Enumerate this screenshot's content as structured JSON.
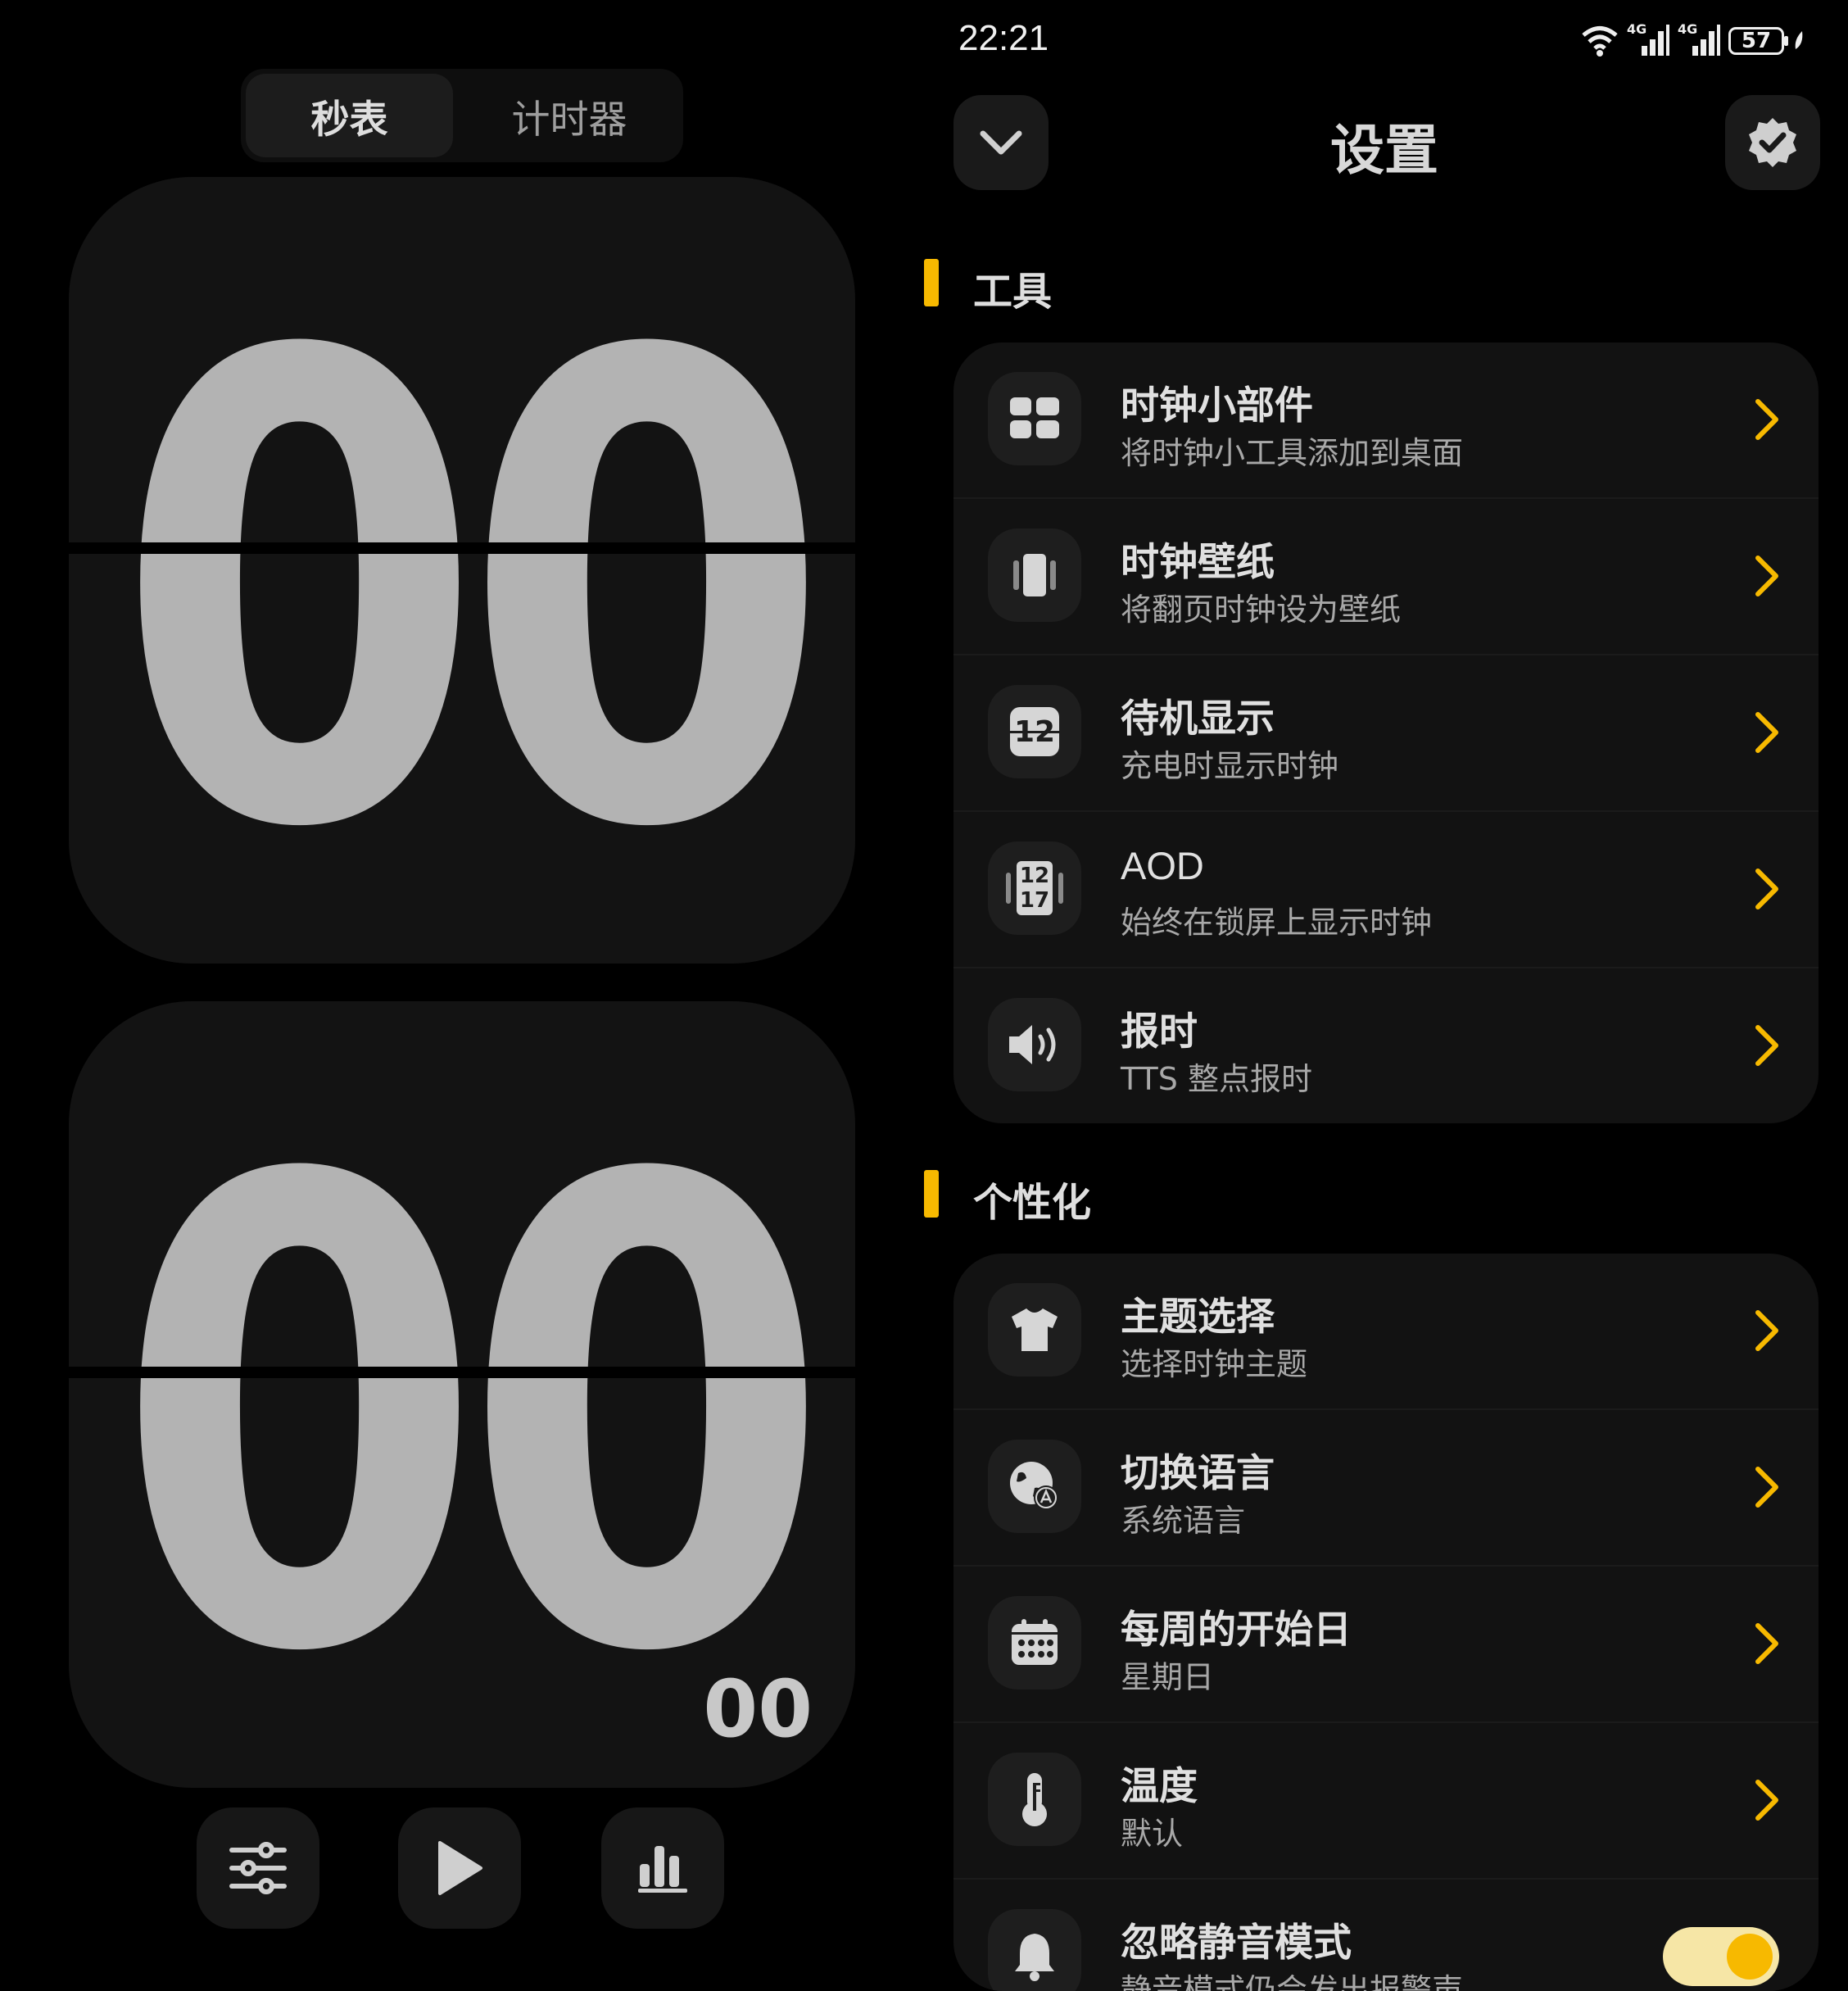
{
  "status_bar": {
    "time": "22:21",
    "network1": "4G",
    "network2": "4G",
    "battery": "57"
  },
  "stopwatch": {
    "tabs": [
      {
        "label": "秒表",
        "active": true
      },
      {
        "label": "计时器",
        "active": false
      }
    ],
    "minutes": "00",
    "seconds": "00",
    "milliseconds": "00",
    "controls": [
      "sliders-icon",
      "play-icon",
      "bar-chart-icon"
    ]
  },
  "settings": {
    "title": "设置",
    "back_icon": "chevron-down-icon",
    "badge_icon": "verified-badge-icon",
    "accent": "#f7b900",
    "sections": [
      {
        "label": "工具",
        "items": [
          {
            "title": "时钟小部件",
            "subtitle": "将时钟小工具添加到桌面",
            "icon": "widgets-icon"
          },
          {
            "title": "时钟壁纸",
            "subtitle": "将翻页时钟设为壁纸",
            "icon": "wallpaper-icon"
          },
          {
            "title": "待机显示",
            "subtitle": "充电时显示时钟",
            "icon": "standby-clock-icon",
            "icon_text": "12"
          },
          {
            "title": "AOD",
            "subtitle": "始终在锁屏上显示时钟",
            "icon": "aod-icon",
            "icon_text": [
              "12",
              "17"
            ]
          },
          {
            "title": "报时",
            "subtitle": "TTS 整点报时",
            "icon": "speaker-icon"
          }
        ]
      },
      {
        "label": "个性化",
        "items": [
          {
            "title": "主题选择",
            "subtitle": "选择时钟主题",
            "icon": "tshirt-icon"
          },
          {
            "title": "切换语言",
            "subtitle": "系统语言",
            "icon": "globe-translate-icon"
          },
          {
            "title": "每周的开始日",
            "subtitle": "星期日",
            "icon": "calendar-icon"
          },
          {
            "title": "温度",
            "subtitle": "默认",
            "icon": "thermometer-icon"
          },
          {
            "title": "忽略静音模式",
            "subtitle": "静音模式仍会发出报警声",
            "icon": "bell-icon",
            "toggle": true
          }
        ]
      }
    ]
  }
}
